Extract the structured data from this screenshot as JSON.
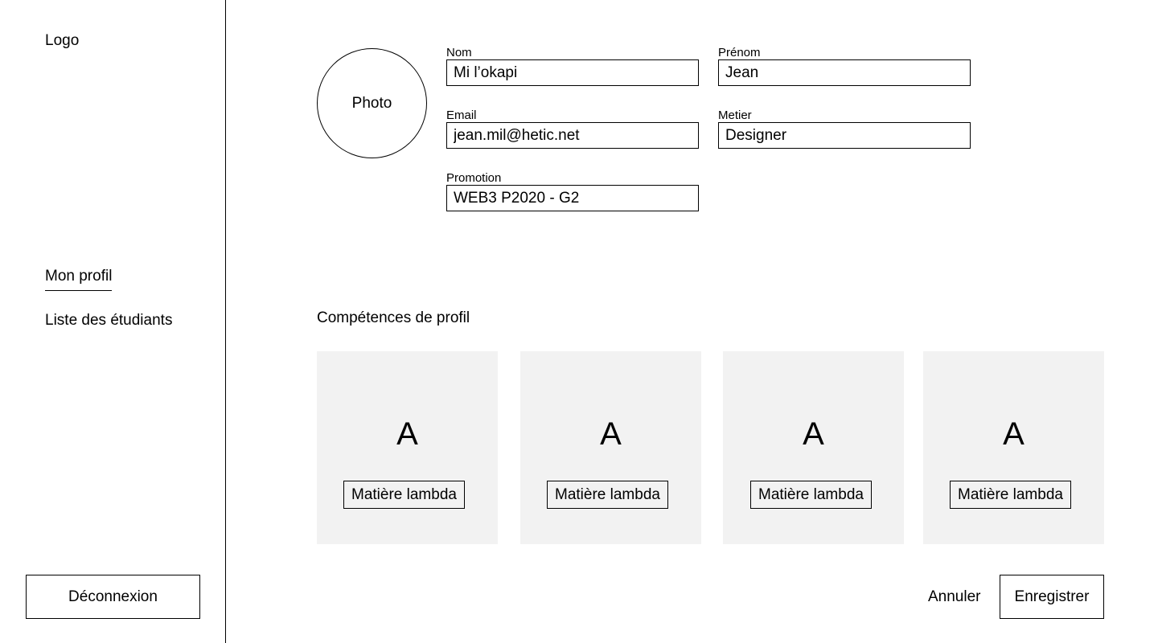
{
  "sidebar": {
    "logo": "Logo",
    "nav": [
      {
        "label": "Mon profil",
        "active": true
      },
      {
        "label": "Liste des étudiants",
        "active": false
      }
    ],
    "logout_label": "Déconnexion"
  },
  "profile": {
    "photo_label": "Photo",
    "fields": {
      "nom": {
        "label": "Nom",
        "value": "Mi l’okapi"
      },
      "prenom": {
        "label": "Prénom",
        "value": "Jean"
      },
      "email": {
        "label": "Email",
        "value": "jean.mil@hetic.net"
      },
      "metier": {
        "label": "Metier",
        "value": "Designer"
      },
      "promotion": {
        "label": "Promotion",
        "value": "WEB3 P2020 - G2"
      }
    }
  },
  "skills": {
    "title": "Compétences de profil",
    "cards": [
      {
        "grade": "A",
        "subject": "Matière lambda"
      },
      {
        "grade": "A",
        "subject": "Matière lambda"
      },
      {
        "grade": "A",
        "subject": "Matière lambda"
      },
      {
        "grade": "A",
        "subject": "Matière lambda"
      }
    ]
  },
  "actions": {
    "cancel_label": "Annuler",
    "save_label": "Enregistrer"
  }
}
